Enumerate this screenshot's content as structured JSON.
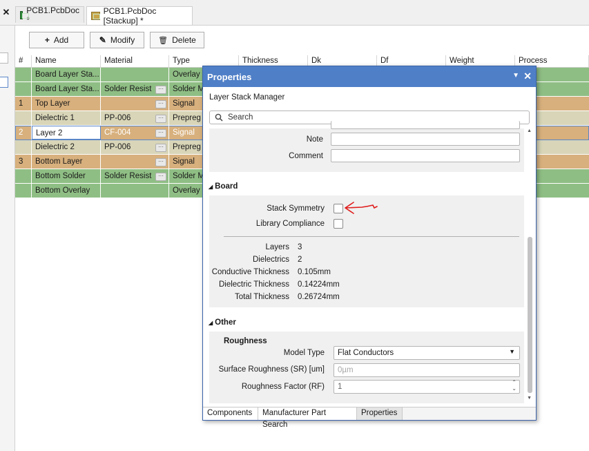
{
  "tabs": {
    "close": "✕",
    "items": [
      {
        "label": "PCB1.PcbDoc *",
        "active": false
      },
      {
        "label": "PCB1.PcbDoc [Stackup] *",
        "active": true
      }
    ]
  },
  "toolbar": {
    "add_icon": "+",
    "add_label": "Add",
    "modify_icon": "✎",
    "modify_label": "Modify",
    "delete_icon": "🗑",
    "delete_label": "Delete"
  },
  "table": {
    "headers": [
      "#",
      "Name",
      "Material",
      "Type",
      "Thickness",
      "Dk",
      "Df",
      "Weight",
      "Process"
    ],
    "rows": [
      {
        "num": "",
        "name": "Board Layer Sta...",
        "material": "",
        "type": "Overlay",
        "kind": "green",
        "dots": false
      },
      {
        "num": "",
        "name": "Board Layer Sta...",
        "material": "Solder Resist",
        "type": "Solder M",
        "kind": "green",
        "dots": true
      },
      {
        "num": "1",
        "name": "Top Layer",
        "material": "",
        "type": "Signal",
        "kind": "copper",
        "dots": true
      },
      {
        "num": "",
        "name": "Dielectric 1",
        "material": "PP-006",
        "type": "Prepreg",
        "kind": "dielectric",
        "dots": true
      },
      {
        "num": "2",
        "name": "Layer 2",
        "material": "CF-004",
        "type": "Signal",
        "kind": "copper-sel",
        "dots": true
      },
      {
        "num": "",
        "name": "Dielectric 2",
        "material": "PP-006",
        "type": "Prepreg",
        "kind": "dielectric",
        "dots": true
      },
      {
        "num": "3",
        "name": "Bottom Layer",
        "material": "",
        "type": "Signal",
        "kind": "copper",
        "dots": true
      },
      {
        "num": "",
        "name": "Bottom Solder",
        "material": "Solder Resist",
        "type": "Solder M",
        "kind": "green",
        "dots": true
      },
      {
        "num": "",
        "name": "Bottom Overlay",
        "material": "",
        "type": "Overlay",
        "kind": "green",
        "dots": false
      }
    ]
  },
  "panel": {
    "title": "Properties",
    "pin_icon": "▼",
    "close_icon": "✕",
    "subtitle": "Layer Stack Manager",
    "search_placeholder": "Search",
    "note_label": "Note",
    "comment_label": "Comment",
    "board": {
      "header": "Board",
      "stack_symmetry_label": "Stack Symmetry",
      "library_compliance_label": "Library Compliance",
      "layers_label": "Layers",
      "layers_value": "3",
      "dielectrics_label": "Dielectrics",
      "dielectrics_value": "2",
      "conductive_label": "Conductive Thickness",
      "conductive_value": "0.105mm",
      "dielectric_label": "Dielectric Thickness",
      "dielectric_value": "0.14224mm",
      "total_label": "Total Thickness",
      "total_value": "0.26724mm"
    },
    "other": {
      "header": "Other",
      "roughness_label": "Roughness",
      "model_type_label": "Model Type",
      "model_type_value": "Flat Conductors",
      "sr_label": "Surface Roughness (SR) [um]",
      "sr_placeholder": "0µm",
      "rf_label": "Roughness Factor (RF)",
      "rf_value": "1"
    },
    "bottom_tabs": [
      "Components",
      "Manufacturer Part Search",
      "Properties"
    ]
  },
  "colors": {
    "green": "#8fbe84",
    "copper": "#d7b07d",
    "dielectric": "#d8d5b8",
    "header_blue": "#4f7fc7",
    "annotation_red": "#e01b1b"
  }
}
